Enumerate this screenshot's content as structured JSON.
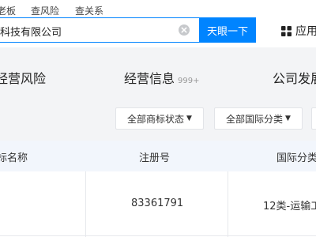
{
  "top_links": [
    "老板",
    "查风险",
    "查关系"
  ],
  "search": {
    "value": "科技有限公司",
    "button_label": "天眼一下"
  },
  "app": {
    "label": "应用"
  },
  "tabs": [
    {
      "label": "经营风险"
    },
    {
      "label": "经营信息",
      "badge": "999+"
    },
    {
      "label": "公司发展"
    }
  ],
  "filters": [
    {
      "label": "全部商标状态"
    },
    {
      "label": "全部国际分类"
    }
  ],
  "table": {
    "headers": [
      "标名称",
      "注册号",
      "国际分类"
    ],
    "rows": [
      [
        "",
        "83361791",
        "12类-运输工"
      ]
    ]
  },
  "colors": {
    "accent": "#0084ff",
    "band": "#f3f4f6",
    "table_header": "#f2f6fc"
  }
}
